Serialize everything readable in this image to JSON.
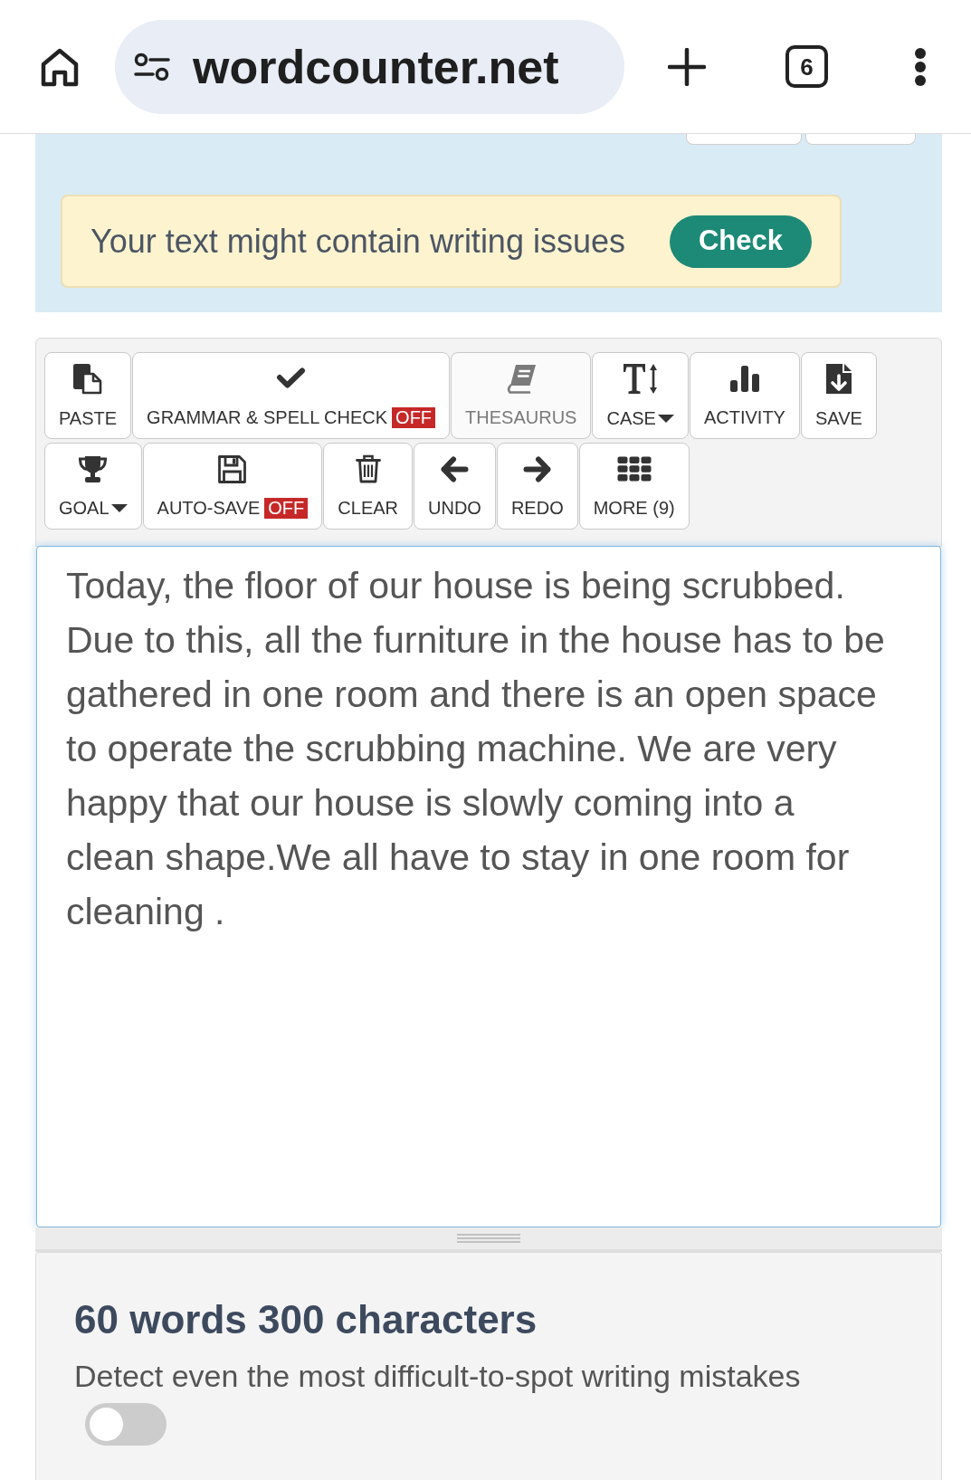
{
  "browser": {
    "url": "wordcounter.net",
    "tab_count": "6"
  },
  "banner": {
    "message": "Your text might contain writing issues",
    "button": "Check"
  },
  "toolbar": {
    "buttons": [
      {
        "label": "PASTE",
        "kind": "paste",
        "dropdown": false,
        "disabled": false
      },
      {
        "label": "GRAMMAR & SPELL CHECK",
        "kind": "grammar",
        "badge": "OFF",
        "dropdown": false,
        "disabled": false
      },
      {
        "label": "THESAURUS",
        "kind": "thesaurus",
        "dropdown": false,
        "disabled": true
      },
      {
        "label": "CASE",
        "kind": "case",
        "dropdown": true,
        "disabled": false
      },
      {
        "label": "ACTIVITY",
        "kind": "activity",
        "dropdown": false,
        "disabled": false
      },
      {
        "label": "SAVE",
        "kind": "save",
        "dropdown": false,
        "disabled": false
      },
      {
        "label": "GOAL",
        "kind": "goal",
        "dropdown": true,
        "disabled": false
      },
      {
        "label": "AUTO-SAVE",
        "kind": "autosave",
        "badge": "OFF",
        "dropdown": false,
        "disabled": false
      },
      {
        "label": "CLEAR",
        "kind": "clear",
        "dropdown": false,
        "disabled": false
      },
      {
        "label": "UNDO",
        "kind": "undo",
        "dropdown": false,
        "disabled": false
      },
      {
        "label": "REDO",
        "kind": "redo",
        "dropdown": false,
        "disabled": false
      },
      {
        "label": "MORE (9)",
        "kind": "more",
        "dropdown": false,
        "disabled": false
      }
    ]
  },
  "editor": {
    "text": "Today, the floor of our house is being scrubbed. Due to this, all the furniture in the house has to be gathered in one room and there is an open space to operate the scrubbing machine. We are very happy that our house is slowly coming into a clean shape.We all have to stay in one room for cleaning ."
  },
  "stats": {
    "heading": "60 words 300 characters",
    "description": "Detect even the most difficult-to-spot writing mistakes",
    "toggle": {
      "on": false
    }
  }
}
